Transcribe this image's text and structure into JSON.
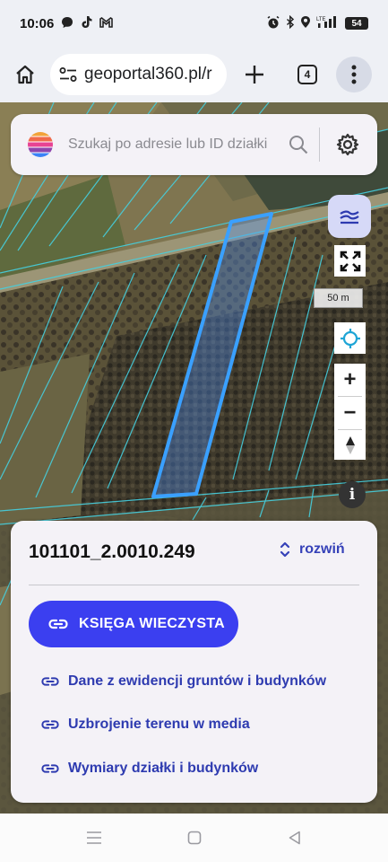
{
  "status_bar": {
    "time": "10:06",
    "battery": "54",
    "network": "LTE"
  },
  "browser": {
    "url": "geoportal360.pl/r",
    "tabs_count": "4"
  },
  "map": {
    "search_placeholder": "Szukaj po adresie lub ID działki",
    "scale_label": "50 m",
    "zoom_in_label": "+",
    "zoom_out_label": "−",
    "info_label": "i",
    "parcel_outline_color": "#3aa0ff"
  },
  "panel": {
    "parcel_id": "101101_2.0010.249",
    "expand_label": "rozwiń",
    "land_registry_button": "KSIĘGA WIECZYSTA",
    "links": [
      "Dane z ewidencji gruntów i budynków",
      "Uzbrojenie terenu w media",
      "Wymiary działki i budynków"
    ]
  },
  "colors": {
    "accent": "#3b3ff0",
    "link": "#2e3bb0",
    "panel_bg": "#f4f2f7"
  }
}
